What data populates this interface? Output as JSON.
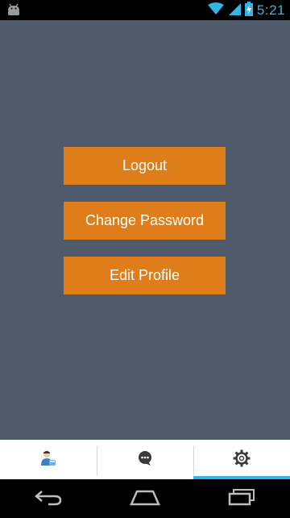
{
  "status_bar": {
    "time": "5:21",
    "icons": [
      "android-icon",
      "wifi-icon",
      "signal-icon",
      "battery-charging-icon"
    ]
  },
  "actions": {
    "logout_label": "Logout",
    "change_password_label": "Change Password",
    "edit_profile_label": "Edit Profile"
  },
  "tabs": [
    {
      "icon": "profile-icon",
      "active": false
    },
    {
      "icon": "chat-icon",
      "active": false
    },
    {
      "icon": "settings-icon",
      "active": true
    }
  ],
  "nav": {
    "icons": [
      "back-icon",
      "home-icon",
      "recent-apps-icon"
    ]
  },
  "colors": {
    "main_background": "#4f5b6b",
    "button": "#e07d1b",
    "accent": "#33b5e5",
    "tab_bar": "#ffffff"
  }
}
